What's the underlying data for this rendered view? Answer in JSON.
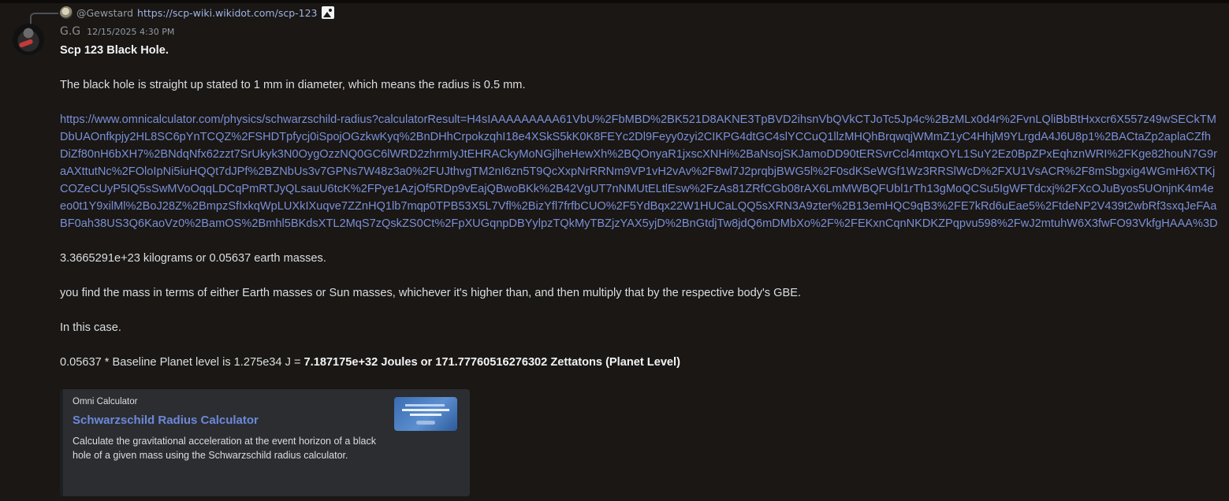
{
  "reply": {
    "username": "@Gewstard",
    "link": "https://scp-wiki.wikidot.com/scp-123"
  },
  "message": {
    "author": "G.G",
    "timestamp": "12/15/2025 4:30 PM",
    "heading": "Scp 123 Black Hole.",
    "line1": "The black hole is straight up stated to 1 mm in diameter, which means the radius is 0.5 mm.",
    "url": "https://www.omnicalculator.com/physics/schwarzschild-radius?calculatorResult=H4sIAAAAAAAAA61VbU%2FbMBD%2BK521D8AKNE3TpBVD2ihsnVbQVkCTJoTc5Jp4c%2BzMLx0d4r%2FvnLQliBbBtHxxcr6X557z49wSECkTMDbUAOnfkpjy2HL8SC6pYnTCQZ%2FSHDTpfycj0iSpojOGzkwKyq%2BnDHhCrpokzqhI18e4XSkS5kK0K8FEYc2Dl9Feyy0zyi2CIKPG4dtGC4slYCCuQ1llzMHQhBrqwqjWMmZ1yC4HhjM9YLrgdA4J6U8p1%2BACtaZp2aplaCZfhDiZf80nH6bXH7%2BNdqNfx62zzt7SrUkyk3N0OygOzzNQ0GC6lWRD2zhrmIyJtEHRACkyMoNGjlheHewXh%2BQOnyaR1jxscXNHi%2BaNsojSKJamoDD90tERSvrCcl4mtqxOYL1SuY2Ez0BpZPxEqhznWRI%2FKge82houN7G9raAXttutNc%2FOloIpNi5iuHQQt7dJPf%2BZNbUs3v7GPNs7W48z3a0%2FUJthvgTM2nI6zn5T9QcXxpNrRRNm9VP1vH2vAv%2F8wl7J2prqbjBWG5l%2F0sdKSeWGf1Wz3RRSlWcD%2FXU1VsACR%2F8mSbgxig4WGmH6XTKjCOZeCUyP5IQ5sSwMVoOqqLDCqPmRTJyQLsauU6tcK%2FPye1AzjOf5RDp9vEajQBwoBKk%2B42VgUT7nNMUtELtlEsw%2FzAs81ZRfCGb08rAX6LmMWBQFUbl1rTh13gMoQCSu5IgWFTdcxj%2FXcOJuByos5UOnjnK4m4eeo0t1Y9xilMl%2BoJ28Z%2BmpzSfIxkqWpLUXkIXuqve7ZZnHQ1lb7mqp0TPB53X5L7Vfl%2BizYfl7frfbCUO%2F5YdBqx22W1HUCaLQQ5sXRN3A9zter%2B13emHQC9qB3%2FE7kRd6uEae5%2FtdeNP2V439t2wbRf3sxqJeFAaBF0ah38US3Q6KaoVz0%2BamOS%2Bmhl5BKdsXTL2MqS7zQskZS0Ct%2FpXUGqnpDBYylpzTQkMyTBZjzYAX5yjD%2BnGtdjTw8jdQ6mDMbXo%2F%2FEKxnCqnNKDKZPqpvu598%2FwJ2mtuhW6X3fwFO93VkfgHAAA%3D",
    "mass_line": "3.3665291e+23 kilograms or 0.05637 earth masses.",
    "method_line": "you find the mass in terms of either Earth masses or Sun masses, whichever it's higher than, and then multiply that by the respective body's GBE.",
    "case_line": "In this case.",
    "result_prefix": "0.05637 * Baseline Planet level is 1.275e34 J = ",
    "result_bold": "7.187175e+32 Joules or 171.77760516276302 Zettatons (Planet Level)"
  },
  "embed": {
    "provider": "Omni Calculator",
    "title": "Schwarzschild Radius Calculator",
    "description": "Calculate the gravitational acceleration at the event horizon of a black hole of a given mass using the Schwarzschild radius calculator.",
    "thumbnail_alt": "Schwarzschild Radius Calculator"
  }
}
